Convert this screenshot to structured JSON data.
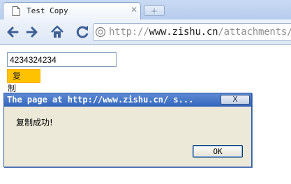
{
  "tab": {
    "title": "Test Copy"
  },
  "toolbar": {
    "url_scheme": "http://",
    "url_host": "www.zishu.cn",
    "url_path": "/attachments/m"
  },
  "page": {
    "input_value": "4234324234",
    "copy_button_label": "复 制"
  },
  "dialog": {
    "title": "The page at http://www.zishu.cn/ s...",
    "close_label": "X",
    "message": "复制成功!",
    "ok_label": "OK"
  },
  "icons": {
    "tab_favicon": "page-icon",
    "tab_close": "close-icon",
    "new_tab": "new-tab-icon",
    "back": "back-arrow-icon",
    "forward": "forward-arrow-icon",
    "home": "home-icon",
    "reload": "reload-icon",
    "page_info": "page-info-icon"
  },
  "colors": {
    "copy_button": "#ffc200",
    "dialog_titlebar": "#3a6cc0",
    "dialog_body": "#ece9d8",
    "chrome_frame": "#c9daf3"
  }
}
